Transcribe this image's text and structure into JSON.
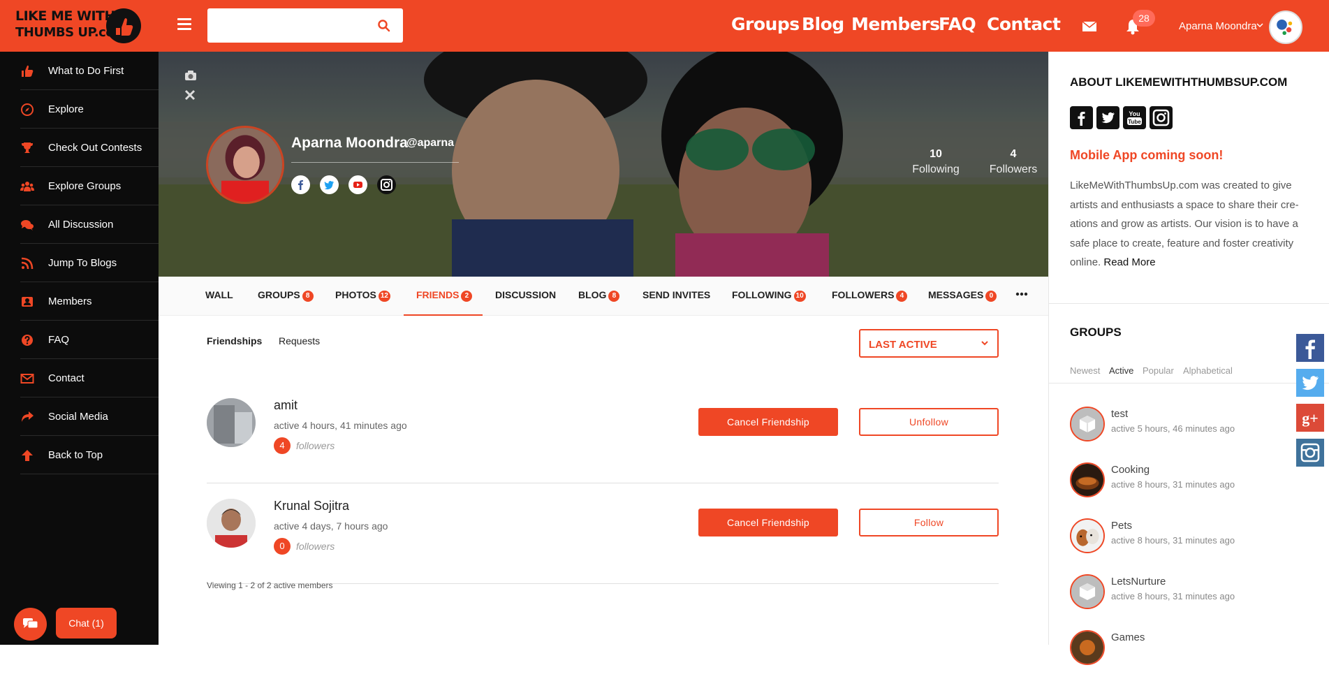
{
  "brand": {
    "line1": "LIKE ME WITH",
    "line2": "THUMBS UP.com",
    "accent": "#ef4725"
  },
  "search": {
    "placeholder": "",
    "value": ""
  },
  "nav": {
    "groups": "Groups",
    "blog": "Blog",
    "members": "Members",
    "faq": "FAQ",
    "contact": "Contact"
  },
  "header": {
    "notifications": "28",
    "user": "Aparna Moondra"
  },
  "sidebar": {
    "items": [
      {
        "label": "What to Do First",
        "icon": "thumbs-up-icon"
      },
      {
        "label": "Explore",
        "icon": "compass-icon"
      },
      {
        "label": "Check Out Contests",
        "icon": "trophy-icon"
      },
      {
        "label": "Explore Groups",
        "icon": "users-icon"
      },
      {
        "label": "All Discussion",
        "icon": "chat-icon"
      },
      {
        "label": "Jump To Blogs",
        "icon": "rss-icon"
      },
      {
        "label": "Members",
        "icon": "members-icon"
      },
      {
        "label": "FAQ",
        "icon": "question-icon"
      },
      {
        "label": "Contact",
        "icon": "envelope-icon"
      },
      {
        "label": "Social Media",
        "icon": "share-icon"
      },
      {
        "label": "Back to Top",
        "icon": "arrow-up-icon"
      }
    ]
  },
  "chat": {
    "label": "Chat (1)"
  },
  "profile": {
    "name": "Aparna Moondra",
    "handle": "@aparna",
    "following_count": "10",
    "following_label": "Following",
    "followers_count": "4",
    "followers_label": "Followers"
  },
  "tabs": [
    {
      "label": "WALL",
      "badge": ""
    },
    {
      "label": "GROUPS",
      "badge": "8"
    },
    {
      "label": "PHOTOS",
      "badge": "12"
    },
    {
      "label": "FRIENDS",
      "badge": "2"
    },
    {
      "label": "DISCUSSION",
      "badge": ""
    },
    {
      "label": "BLOG",
      "badge": "8"
    },
    {
      "label": "SEND INVITES",
      "badge": ""
    },
    {
      "label": "FOLLOWING",
      "badge": "10"
    },
    {
      "label": "FOLLOWERS",
      "badge": "4"
    },
    {
      "label": "MESSAGES",
      "badge": "0"
    }
  ],
  "subnav": {
    "friendships": "Friendships",
    "requests": "Requests"
  },
  "sort": {
    "value": "LAST ACTIVE"
  },
  "members": [
    {
      "name": "amit",
      "active": "active 4 hours, 41 minutes ago",
      "followers": "4",
      "followers_label": "followers",
      "cancel": "Cancel Friendship",
      "follow": "Unfollow"
    },
    {
      "name": "Krunal Sojitra",
      "active": "active 4 days, 7 hours ago",
      "followers": "0",
      "followers_label": "followers",
      "cancel": "Cancel Friendship",
      "follow": "Follow"
    }
  ],
  "viewing": "Viewing 1 - 2 of 2 active members",
  "about": {
    "title": "ABOUT LIKEMEWITHTHUMBSUP.COM",
    "mobile": "Mobile App coming soon!",
    "text": "LikeMeWithThumbsUp.com was created to give artists and enthusiasts a space to share their cre-ations and grow as artists. Our vision is to have a safe place to create, feature and foster creativity online.",
    "read_more": "Read More"
  },
  "groups_widget": {
    "title": "GROUPS",
    "tabs": [
      "Newest",
      "Active",
      "Popular",
      "Alphabetical"
    ],
    "items": [
      {
        "name": "test",
        "active": "active 5 hours, 46 minutes ago"
      },
      {
        "name": "Cooking",
        "active": "active 8 hours, 31 minutes ago"
      },
      {
        "name": "Pets",
        "active": "active 8 hours, 31 minutes ago"
      },
      {
        "name": "LetsNurture",
        "active": "active 8 hours, 31 minutes ago"
      },
      {
        "name": "Games",
        "active": ""
      }
    ]
  }
}
